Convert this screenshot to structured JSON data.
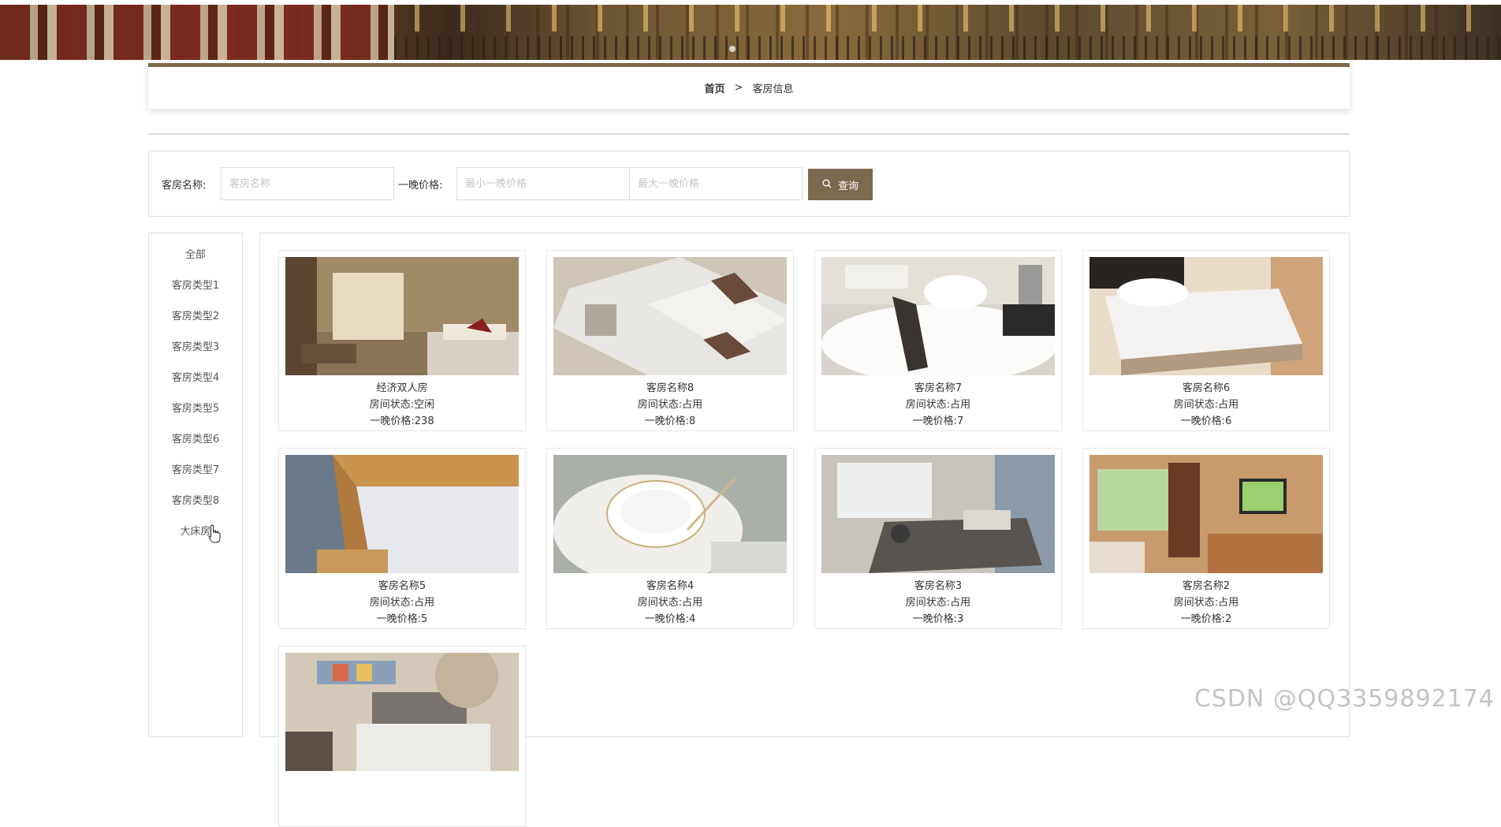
{
  "breadcrumb": {
    "home": "首页",
    "separator": ">",
    "current": "客房信息"
  },
  "search": {
    "room_name_label": "客房名称:",
    "room_name_placeholder": "客房名称",
    "price_label": "一晚价格:",
    "min_price_placeholder": "最小一晚价格",
    "max_price_placeholder": "最大一晚价格",
    "button_label": "查询",
    "button_icon": "search-icon"
  },
  "sidebar": {
    "items": [
      {
        "label": "全部"
      },
      {
        "label": "客房类型1"
      },
      {
        "label": "客房类型2"
      },
      {
        "label": "客房类型3"
      },
      {
        "label": "客房类型4"
      },
      {
        "label": "客房类型5"
      },
      {
        "label": "客房类型6"
      },
      {
        "label": "客房类型7"
      },
      {
        "label": "客房类型8"
      },
      {
        "label": "大床房"
      }
    ]
  },
  "rooms": [
    {
      "name": "经济双人房",
      "status": "房间状态:空闲",
      "price": "一晚价格:238"
    },
    {
      "name": "客房名称8",
      "status": "房间状态:占用",
      "price": "一晚价格:8"
    },
    {
      "name": "客房名称7",
      "status": "房间状态:占用",
      "price": "一晚价格:7"
    },
    {
      "name": "客房名称6",
      "status": "房间状态:占用",
      "price": "一晚价格:6"
    },
    {
      "name": "客房名称5",
      "status": "房间状态:占用",
      "price": "一晚价格:5"
    },
    {
      "name": "客房名称4",
      "status": "房间状态:占用",
      "price": "一晚价格:4"
    },
    {
      "name": "客房名称3",
      "status": "房间状态:占用",
      "price": "一晚价格:3"
    },
    {
      "name": "客房名称2",
      "status": "房间状态:占用",
      "price": "一晚价格:2"
    },
    {
      "name": "",
      "status": "",
      "price": ""
    }
  ],
  "watermark": "CSDN @QQ3359892174",
  "colors": {
    "accent": "#7a6a4e",
    "breadcrumb_border": "#7a6848"
  }
}
